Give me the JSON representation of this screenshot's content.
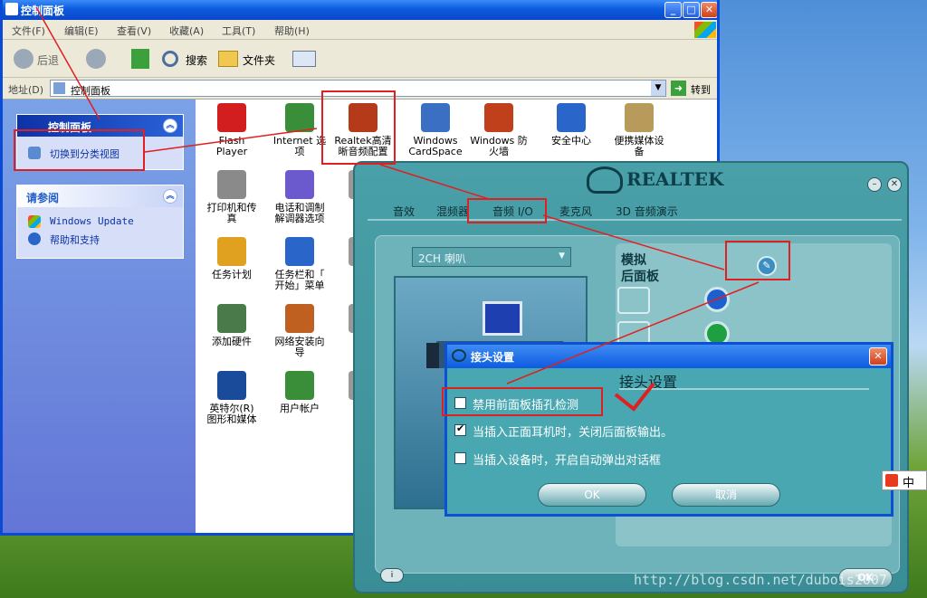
{
  "explorer": {
    "title": "控制面板",
    "menu": [
      "文件(F)",
      "编辑(E)",
      "查看(V)",
      "收藏(A)",
      "工具(T)",
      "帮助(H)"
    ],
    "toolbar": {
      "back": "后退",
      "search": "搜索",
      "folders": "文件夹"
    },
    "address": {
      "label": "地址(D)",
      "value": "控制面板",
      "go": "转到"
    },
    "left_pane": {
      "panel_title": "控制面板",
      "switch_view": "切换到分类视图",
      "see_also_title": "请参阅",
      "see_also": [
        "Windows Update",
        "帮助和支持"
      ]
    },
    "items": [
      {
        "label": "Flash\nPlayer",
        "icon": "flash-icon",
        "color": "#d21e1e"
      },
      {
        "label": "Internet 选\n项",
        "icon": "internet-options-icon",
        "color": "#3a8e3a"
      },
      {
        "label": "Realtek高清\n晰音频配置",
        "icon": "realtek-speaker-icon",
        "color": "#b53a1a"
      },
      {
        "label": "Windows\nCardSpace",
        "icon": "cardspace-icon",
        "color": "#3a6fc4"
      },
      {
        "label": "Windows 防\n火墙",
        "icon": "firewall-icon",
        "color": "#c0401c"
      },
      {
        "label": "安全中心",
        "icon": "security-center-icon",
        "color": "#2a66c9"
      },
      {
        "label": "便携媒体设\n备",
        "icon": "portable-media-icon",
        "color": "#b89b5a"
      },
      {
        "label": "打印机和传\n真",
        "icon": "printer-icon",
        "color": "#8a8a8a"
      },
      {
        "label": "电话和调制\n解调器选项",
        "icon": "phone-modem-icon",
        "color": "#6a5acd"
      },
      {
        "label": "电",
        "icon": "power-icon",
        "color": "#999999"
      },
      {
        "label": "任务计划",
        "icon": "task-scheduler-icon",
        "color": "#e0a020"
      },
      {
        "label": "任务栏和「\n开始」菜单",
        "icon": "taskbar-icon",
        "color": "#2a66c9"
      },
      {
        "label": "日期",
        "icon": "date-time-icon",
        "color": "#999999"
      },
      {
        "label": "添加硬件",
        "icon": "add-hardware-icon",
        "color": "#4a7a4a"
      },
      {
        "label": "网络安装向\n导",
        "icon": "network-setup-icon",
        "color": "#c06020"
      },
      {
        "label": "网",
        "icon": "network-icon",
        "color": "#999999"
      },
      {
        "label": "英特尔(R)\n图形和媒体",
        "icon": "intel-graphics-icon",
        "color": "#1a4a9a"
      },
      {
        "label": "用户帐户",
        "icon": "user-accounts-icon",
        "color": "#3a8e3a"
      },
      {
        "label": "E",
        "icon": "misc-icon",
        "color": "#999999"
      }
    ]
  },
  "realtek": {
    "logo": "REALTEK",
    "tabs": [
      "音效",
      "混频器",
      "音频 I/O",
      "麦克风",
      "3D 音频演示"
    ],
    "speaker_select": "2CH 喇叭",
    "analog": "模拟",
    "back_panel": "后面板",
    "ok": "OK",
    "jack_colors": [
      "#1e5fd0",
      "#1ea040"
    ]
  },
  "dialog": {
    "title": "接头设置",
    "heading": "接头设置",
    "options": [
      {
        "label": "禁用前面板插孔检测",
        "checked": false
      },
      {
        "label": "当插入正面耳机时，关闭后面板输出。",
        "checked": true
      },
      {
        "label": "当插入设备时，开启自动弹出对话框",
        "checked": false
      }
    ],
    "ok": "OK",
    "cancel": "取消"
  },
  "ime": "中",
  "watermark": "http://blog.csdn.net/dubois2007"
}
